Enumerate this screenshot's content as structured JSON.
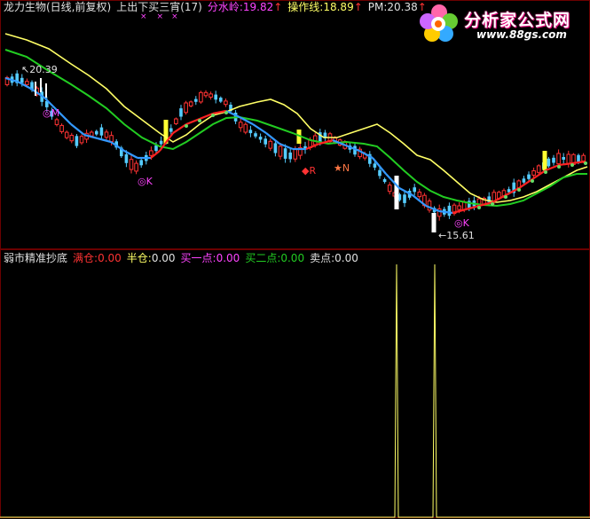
{
  "top_panel": {
    "stock_name": "龙力生物(日线,前复权)",
    "indicator_name": "上出下买三宵(17)",
    "fenshuiling_label": "分水岭:",
    "fenshuiling_value": "19.82",
    "caozuoxian_label": "操作线:",
    "caozuoxian_value": "18.89",
    "pm_label": "PM:",
    "pm_value": "20.38",
    "up_arrow": "↑",
    "high_marker": "20.39",
    "low_marker": "←15.61",
    "signal_labels": {
      "k1": "◎K",
      "k2": "◎K",
      "k3": "◎K",
      "r": "◆R",
      "n": "★N",
      "m1": "◎M"
    },
    "top_x_marks": [
      "×",
      "×",
      "×"
    ],
    "chart_data": {
      "type": "candlestick",
      "title": "龙力生物(日线,前复权)",
      "lines": [
        {
          "name": "分水岭",
          "color": "#ffff66"
        },
        {
          "name": "操作线",
          "color": "#22cc22"
        }
      ],
      "high": 20.39,
      "low": 15.61
    },
    "colors": {
      "up": "#ff3333",
      "down": "#55ccff",
      "yellow_line": "#ffff66",
      "green_line": "#22cc22",
      "blue_line": "#3399ff",
      "signal_magenta": "#ff44ff"
    }
  },
  "bottom_panel": {
    "indicator_name": "弱市精准抄底",
    "mancang_label": "满仓:",
    "mancang_value": "0.00",
    "bancang_label": "半仓:",
    "bancang_value": "0.00",
    "mai1_label": "买一点:",
    "mai1_value": "0.00",
    "mai2_label": "买二点:",
    "mai2_value": "0.00",
    "maidian_label": "卖点:",
    "maidian_value": "0.00",
    "chart_data": {
      "type": "line",
      "series": [
        {
          "values": [
            0,
            1,
            0,
            1,
            0
          ]
        }
      ]
    }
  },
  "watermark": {
    "title": "分析家公式网",
    "url": "www.88gs.com"
  }
}
